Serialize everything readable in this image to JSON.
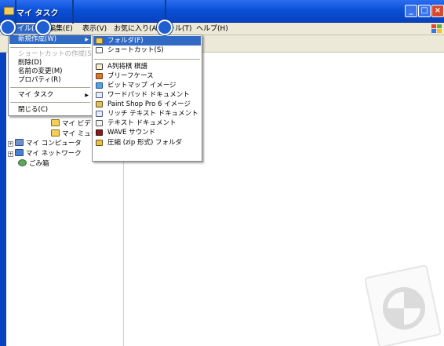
{
  "window": {
    "title": "マイ タスク",
    "buttons": {
      "minimize": "_",
      "maximize": "□",
      "close": "×"
    }
  },
  "menubar": {
    "items": [
      {
        "label": "ファイル(F)"
      },
      {
        "label": "編集(E)"
      },
      {
        "label": "表示(V)"
      },
      {
        "label": "お気に入り(A)"
      },
      {
        "label": "ツール(T)"
      },
      {
        "label": "ヘルプ(H)"
      }
    ]
  },
  "file_menu": {
    "items": [
      {
        "label": "新規作成(W)",
        "state": "highlighted",
        "submenu": true
      },
      {
        "label": "ショートカットの作成(S)",
        "state": "disabled"
      },
      {
        "label": "削除(D)"
      },
      {
        "label": "名前の変更(M)"
      },
      {
        "label": "プロパティ(R)"
      },
      {
        "label": "マイ タスク",
        "submenu": true
      },
      {
        "label": "閉じる(C)"
      }
    ]
  },
  "new_submenu": {
    "items": [
      {
        "label": "フォルダ(F)",
        "icon": "folder-icon",
        "color": "#f4cd5a",
        "state": "highlighted"
      },
      {
        "label": "ショートカット(S)",
        "icon": "shortcut-icon",
        "color": "#ffffff"
      },
      {
        "label": "A列将棋 棋譜",
        "icon": "shogi-icon",
        "color": "#f7efc8"
      },
      {
        "label": "ブリーフケース",
        "icon": "briefcase-icon",
        "color": "#d1782b"
      },
      {
        "label": "ビットマップ イメージ",
        "icon": "bitmap-icon",
        "color": "#5aa0e0"
      },
      {
        "label": "ワードパッド ドキュメント",
        "icon": "wordpad-icon",
        "color": "#e8ecf4"
      },
      {
        "label": "Paint Shop Pro 6 イメージ",
        "icon": "paintshop-icon",
        "color": "#e0c060"
      },
      {
        "label": "リッチ テキスト ドキュメント",
        "icon": "rtf-icon",
        "color": "#e8ecf4"
      },
      {
        "label": "テキスト ドキュメント",
        "icon": "text-doc-icon",
        "color": "#f4f4f4"
      },
      {
        "label": "WAVE サウンド",
        "icon": "wave-icon",
        "color": "#8b1a1a"
      },
      {
        "label": "圧縮 (zip 形式) フォルダ",
        "icon": "zip-folder-icon",
        "color": "#e8c24a"
      }
    ]
  },
  "tree": {
    "items": [
      {
        "label": "マイ ビデオ",
        "icon": "video-folder-icon",
        "color": "#f4cd5a",
        "expander": ""
      },
      {
        "label": "マイ ミュージック",
        "icon": "music-folder-icon",
        "color": "#f4cd5a",
        "expander": ""
      },
      {
        "label": "マイ コンピュータ",
        "icon": "computer-icon",
        "color": "#6f8fc8",
        "expander": "+"
      },
      {
        "label": "マイ ネットワーク",
        "icon": "network-icon",
        "color": "#4a7fd0",
        "expander": "+"
      },
      {
        "label": "ごみ箱",
        "icon": "recycle-bin-icon",
        "color": "#5ea55e",
        "expander": ""
      }
    ]
  },
  "colors": {
    "titlebar": "#0a50d6",
    "highlight": "#316ac5",
    "menubar": "#ece9d8"
  }
}
